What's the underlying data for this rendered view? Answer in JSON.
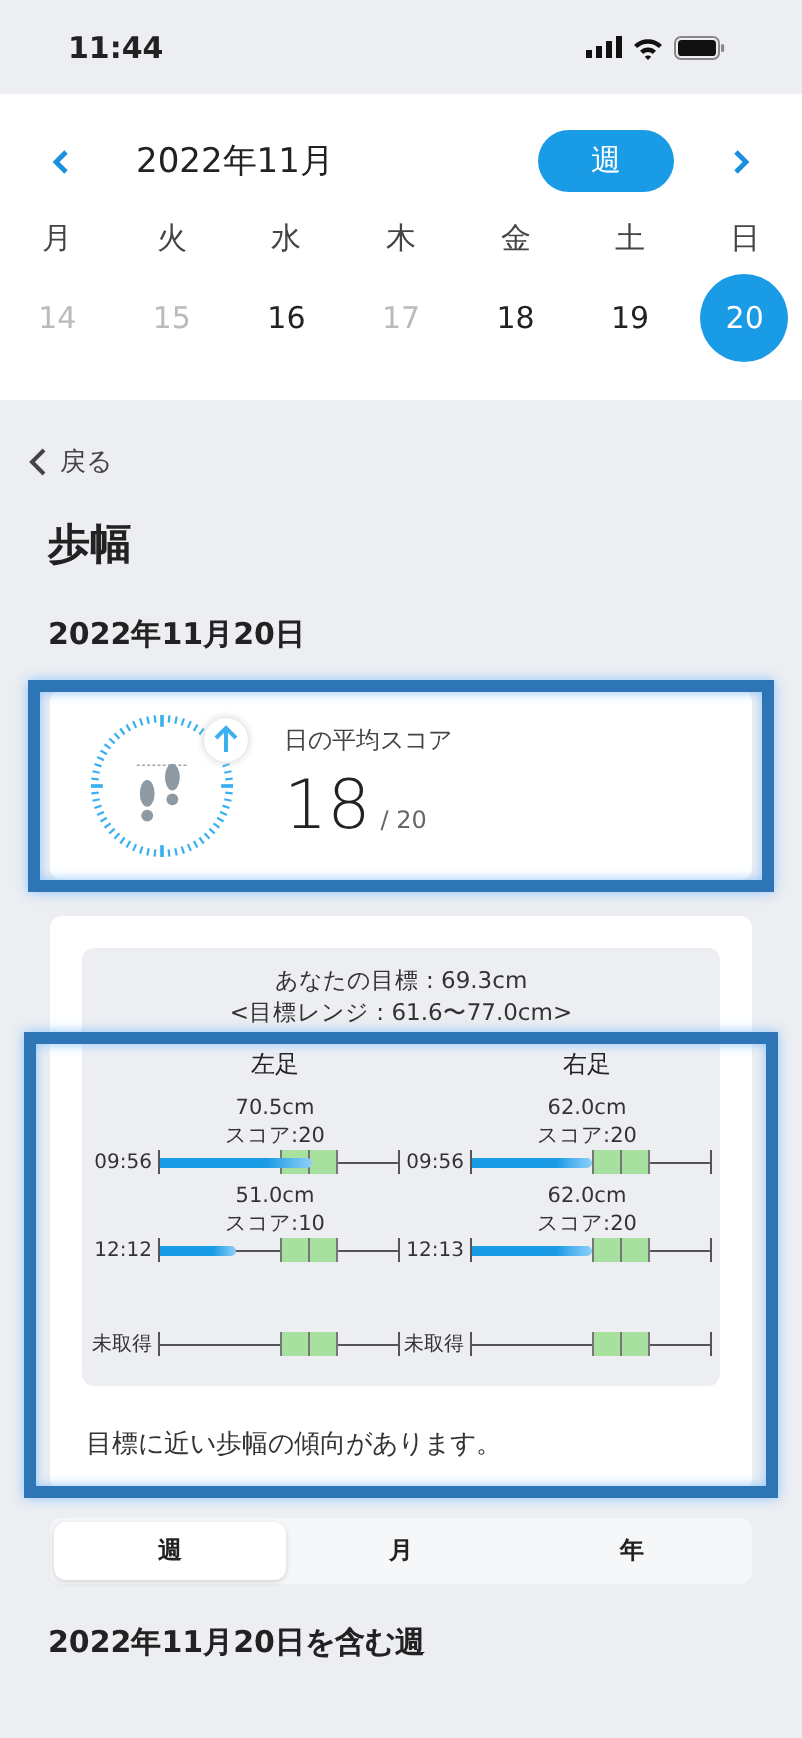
{
  "status_bar": {
    "time": "11:44"
  },
  "calendar": {
    "month": "2022年11月",
    "view_button": "週",
    "weekdays": [
      "月",
      "火",
      "水",
      "木",
      "金",
      "土",
      "日"
    ],
    "days": [
      {
        "label": "14",
        "disabled": true,
        "selected": false
      },
      {
        "label": "15",
        "disabled": true,
        "selected": false
      },
      {
        "label": "16",
        "disabled": false,
        "selected": false
      },
      {
        "label": "17",
        "disabled": true,
        "selected": false
      },
      {
        "label": "18",
        "disabled": false,
        "selected": false
      },
      {
        "label": "19",
        "disabled": false,
        "selected": false
      },
      {
        "label": "20",
        "disabled": false,
        "selected": true
      }
    ]
  },
  "back": "戻る",
  "title": "歩幅",
  "date": "2022年11月20日",
  "score_card": {
    "label": "日の平均スコア",
    "score": "18",
    "max": "/ 20"
  },
  "target": {
    "goal": "あなたの目標 : 69.3cm",
    "range": "<目標レンジ : 61.6〜77.0cm>"
  },
  "feet": [
    {
      "name": "左足",
      "rows": [
        {
          "kind": "measured",
          "length": "70.5cm",
          "score": "スコア:20",
          "time": "09:56",
          "level": 0.64
        },
        {
          "kind": "measured",
          "length": "51.0cm",
          "score": "スコア:10",
          "time": "12:12",
          "level": 0.32
        },
        {
          "kind": "missing",
          "time": "未取得"
        }
      ]
    },
    {
      "name": "右足",
      "rows": [
        {
          "kind": "measured",
          "length": "62.0cm",
          "score": "スコア:20",
          "time": "09:56",
          "level": 0.5
        },
        {
          "kind": "measured",
          "length": "62.0cm",
          "score": "スコア:20",
          "time": "12:13",
          "level": 0.5
        },
        {
          "kind": "missing",
          "time": "未取得"
        }
      ]
    }
  ],
  "summary": "目標に近い歩幅の傾向があります。",
  "period_tabs": [
    {
      "label": "週",
      "selected": true
    },
    {
      "label": "月",
      "selected": false
    },
    {
      "label": "年",
      "selected": false
    }
  ],
  "week_heading": "2022年11月20日を含む週"
}
